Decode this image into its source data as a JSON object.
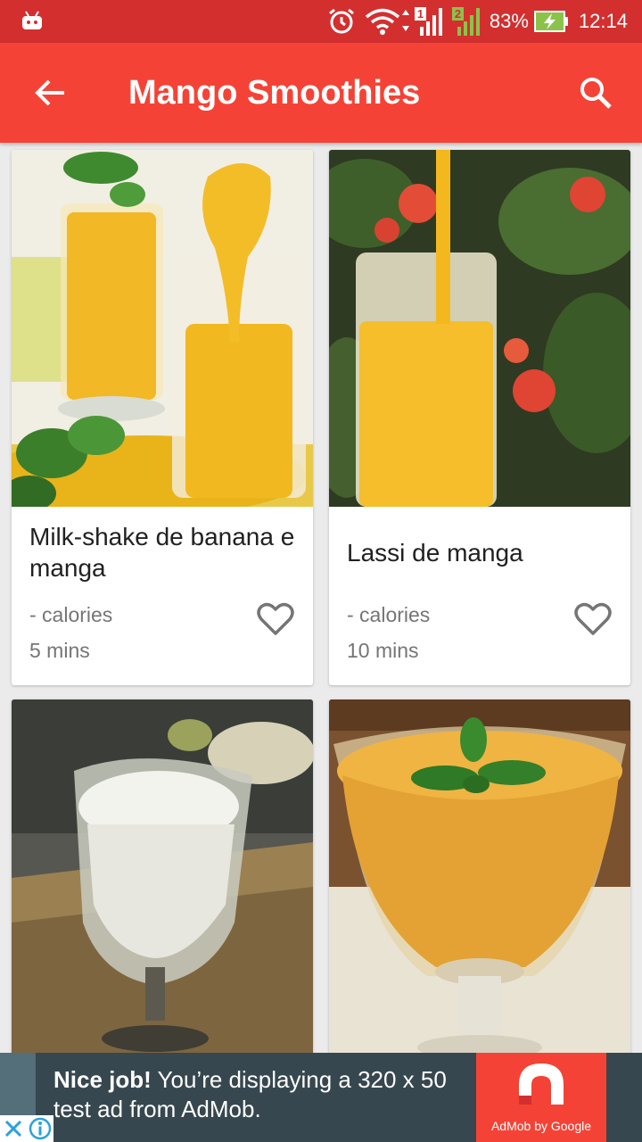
{
  "status_bar": {
    "battery_percent": "83%",
    "time": "12:14",
    "sim1_label": "1",
    "sim2_label": "2",
    "icons": [
      "android-notification-icon",
      "alarm-icon",
      "wifi-icon",
      "signal-sim1-icon",
      "signal-sim2-icon",
      "battery-charging-icon"
    ]
  },
  "app_bar": {
    "title": "Mango Smoothies",
    "back_icon": "arrow-back-icon",
    "search_icon": "search-icon",
    "color": "#f44336",
    "status_color": "#d32f2f"
  },
  "recipes": [
    {
      "title": "Milk-shake de banana e manga",
      "calories": "- calories",
      "time": "5 mins",
      "favorite_icon": "heart-outline-icon"
    },
    {
      "title": "Lassi de manga",
      "calories": "- calories",
      "time": "10 mins",
      "favorite_icon": "heart-outline-icon"
    },
    {
      "title": "",
      "calories": "",
      "time": ""
    },
    {
      "title": "",
      "calories": "",
      "time": ""
    }
  ],
  "ad": {
    "headline": "Nice job!",
    "body": " You’re displaying a 320 x 50 test ad from AdMob.",
    "logo_label": "AdMob by Google",
    "logo_color": "#f44336"
  }
}
